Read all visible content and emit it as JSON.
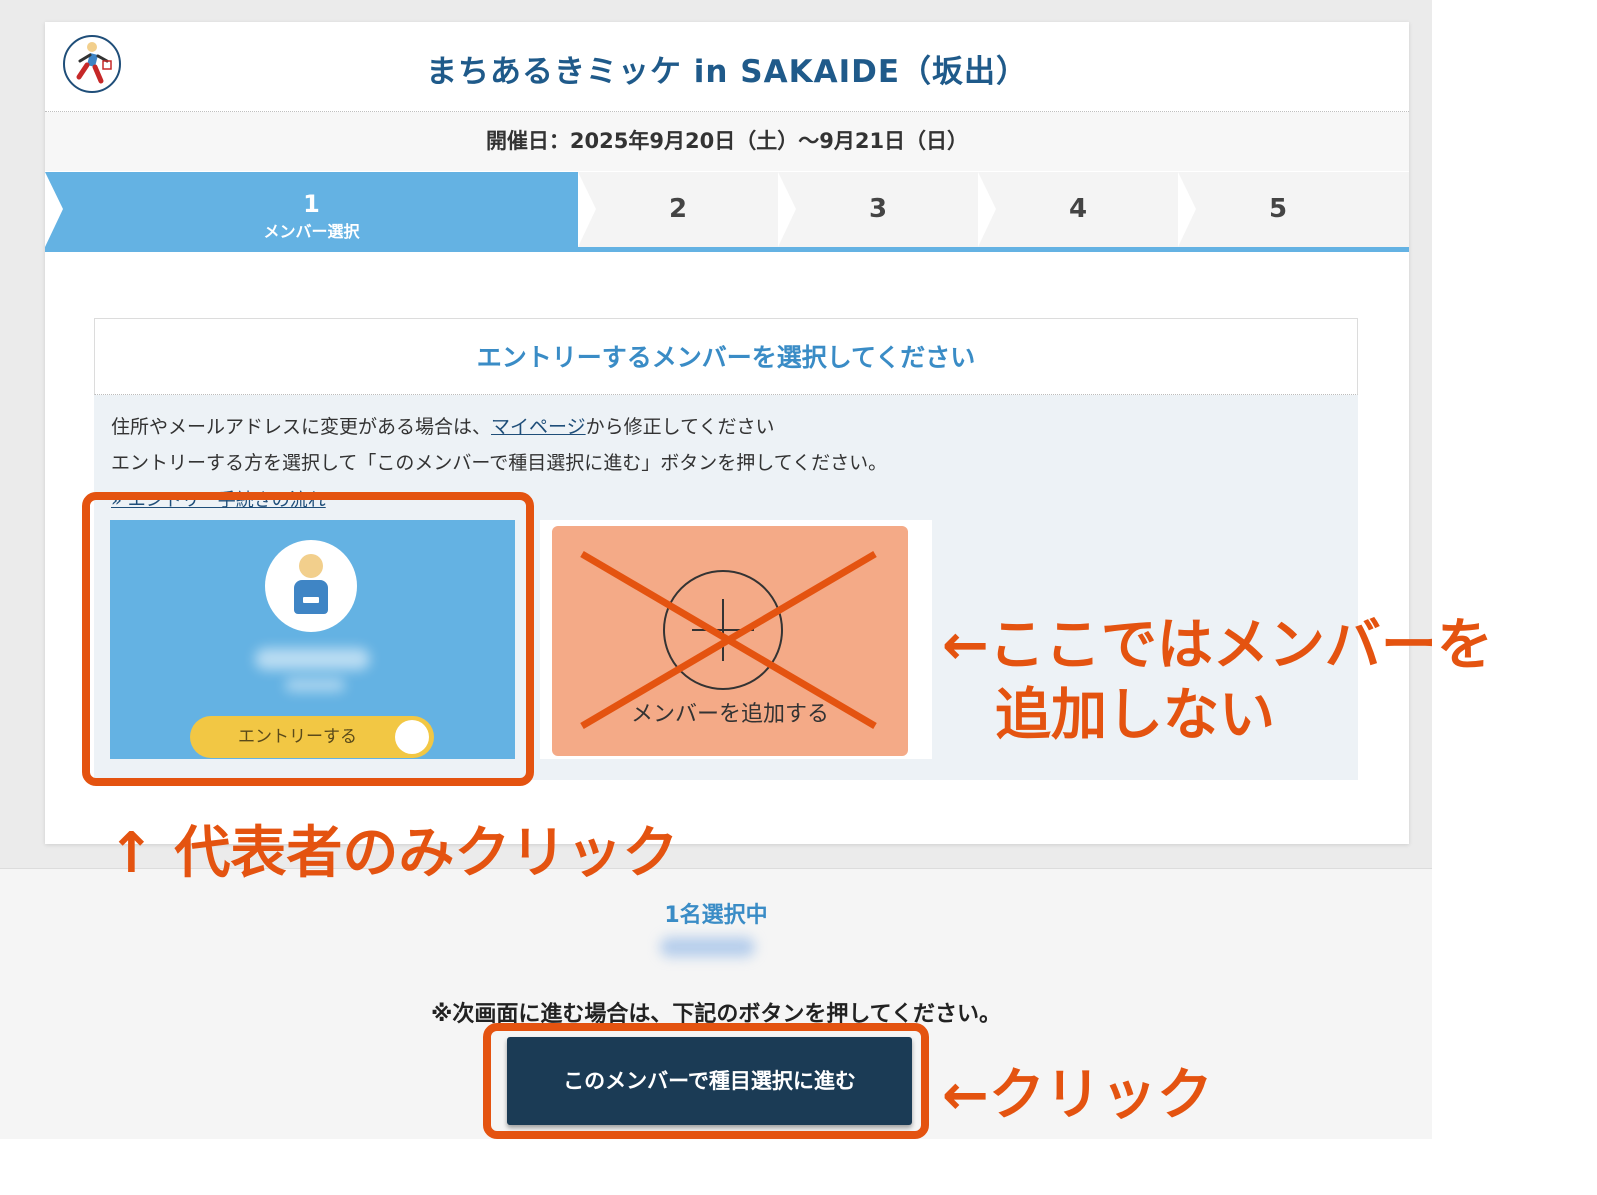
{
  "header": {
    "title": "まちあるきミッケ in SAKAIDE（坂出）",
    "date": "開催日：2025年9月20日（土）〜9月21日（日）"
  },
  "steps": [
    {
      "num": "1",
      "label": "メンバー選択",
      "active": true
    },
    {
      "num": "2"
    },
    {
      "num": "3"
    },
    {
      "num": "4"
    },
    {
      "num": "5"
    }
  ],
  "panel": {
    "heading": "エントリーするメンバーを選択してください",
    "line1_before": "住所やメールアドレスに変更がある場合は、",
    "line1_link": "マイページ",
    "line1_after": "から修正してください",
    "line2": "エントリーする方を選択して「このメンバーで種目選択に進む」ボタンを押してください。",
    "flow_link": "» エントリー手続きの流れ"
  },
  "member": {
    "toggle_label": "エントリーする"
  },
  "add_member": {
    "label": "メンバーを追加する"
  },
  "footer": {
    "selected_count": "1名選択中",
    "note": "※次画面に進む場合は、下記のボタンを押してください。",
    "proceed_button": "このメンバーで種目選択に進む"
  },
  "annotations": {
    "no_add_line1": "←ここではメンバーを",
    "no_add_line2": "追加しない",
    "rep_only": "↑ 代表者のみクリック",
    "click": "←クリック",
    "color": "#e45310"
  },
  "colors": {
    "accent": "#64b2e3",
    "title": "#1f5a8a",
    "toggle": "#f2c744",
    "add_card": "#f4aa87",
    "button": "#1b3b55"
  }
}
